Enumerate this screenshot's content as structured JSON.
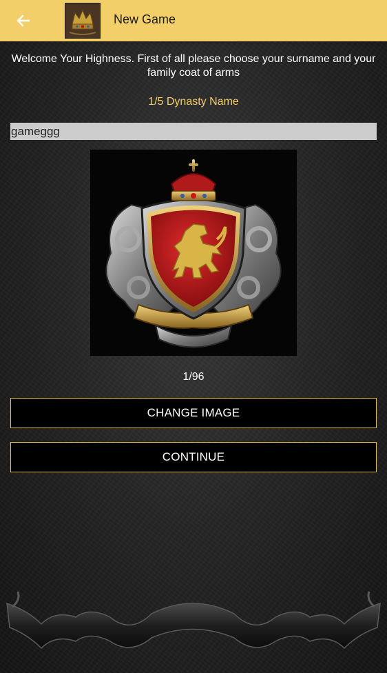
{
  "appbar": {
    "title": "New Game",
    "back_icon": "arrow-left-icon",
    "app_icon": "crown-emblem-icon",
    "background_color": "#f3cf6a"
  },
  "intro": {
    "welcome_text": "Welcome Your Highness. First of all please choose your surname and your family coat of arms",
    "step_label": "1/5 Dynasty Name"
  },
  "dynasty_name": {
    "value": "gameggg"
  },
  "coat_of_arms": {
    "image_icon": "lion-crest-shield",
    "counter": "1/96"
  },
  "buttons": {
    "change_image": "CHANGE IMAGE",
    "continue": "CONTINUE"
  },
  "colors": {
    "accent_gold": "#f3cf6a",
    "button_border": "#e0bd5e",
    "shield_red": "#c8161b",
    "lion_gold": "#d9b447"
  }
}
